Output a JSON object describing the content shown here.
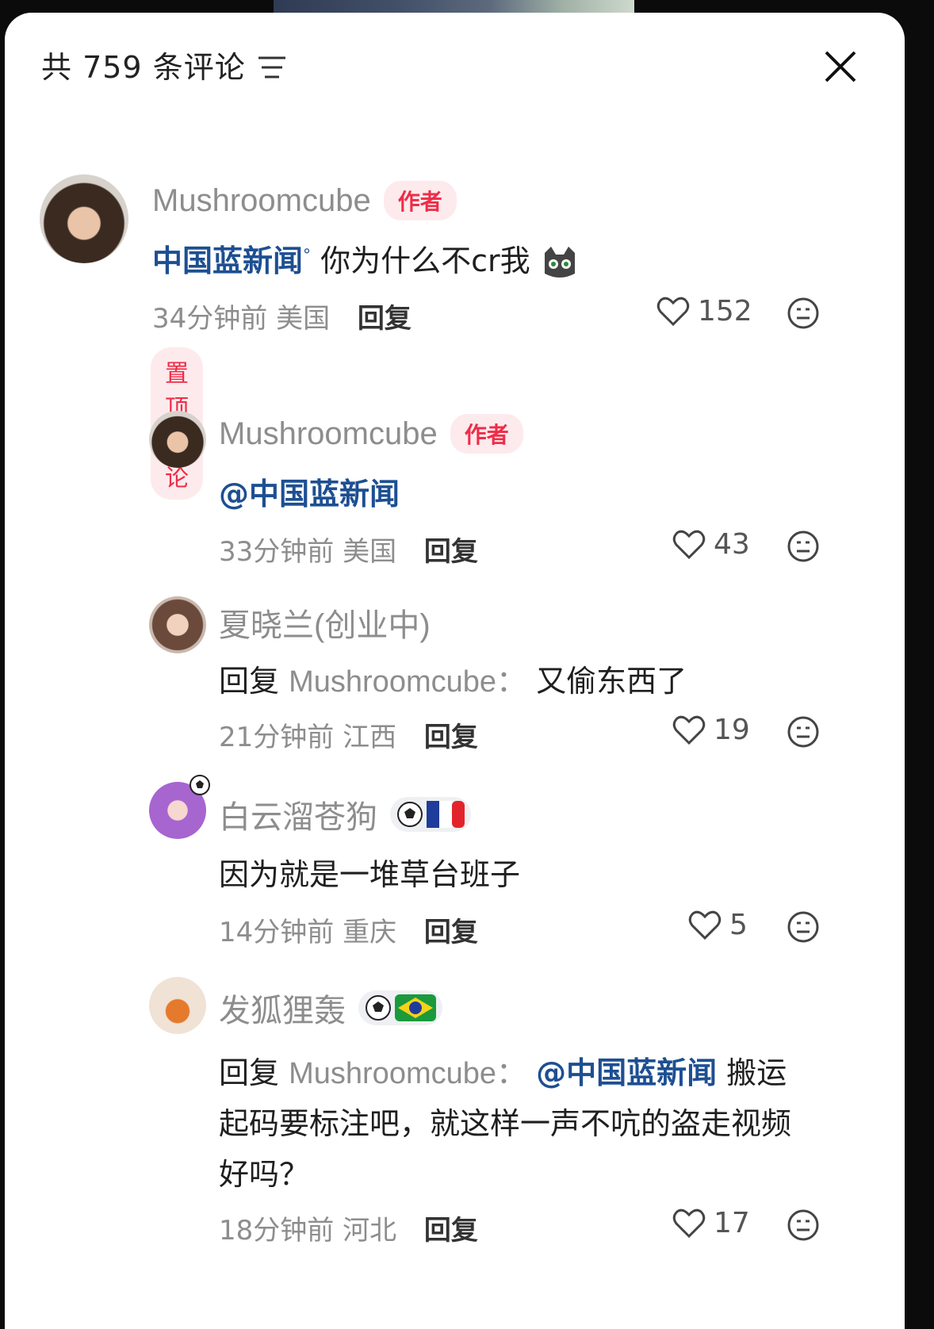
{
  "header": {
    "title": "共 759 条评论"
  },
  "comments": [
    {
      "user": "Mushroomcube",
      "badge": "作者",
      "mention": "中国蓝新闻",
      "text": "你为什么不cr我",
      "time": "34分钟前",
      "location": "美国",
      "reply": "回复",
      "likes": "152",
      "pinned": "置顶评论"
    },
    {
      "user": "Mushroomcube",
      "badge": "作者",
      "mention": "@中国蓝新闻",
      "time": "33分钟前",
      "location": "美国",
      "reply": "回复",
      "likes": "43"
    },
    {
      "user": "夏晓兰(创业中)",
      "reply_prefix": "回复",
      "reply_to": "Mushroomcube",
      "text": "又偷东西了",
      "time": "21分钟前",
      "location": "江西",
      "reply": "回复",
      "likes": "19"
    },
    {
      "user": "白云溜苍狗",
      "text": "因为就是一堆草台班子",
      "time": "14分钟前",
      "location": "重庆",
      "reply": "回复",
      "likes": "5"
    },
    {
      "user": "发狐狸轰",
      "reply_prefix": "回复",
      "reply_to": "Mushroomcube",
      "mention": "@中国蓝新闻",
      "text_line1": "搬运",
      "text_line2": "起码要标注吧，就这样一声不吭的盗走视频",
      "text_line3": "好吗？",
      "time": "18分钟前",
      "location": "河北",
      "reply": "回复",
      "likes": "17"
    }
  ],
  "colors": {
    "accent_red": "#ee2d49",
    "mention_blue": "#1d4f92",
    "meta_gray": "#8d8d8d"
  },
  "icons": [
    "filter-icon",
    "close-icon",
    "heart-icon",
    "dislike-face-icon",
    "soccer-ball-icon",
    "france-flag-icon",
    "brazil-flag-icon",
    "cat-sticker-icon"
  ]
}
